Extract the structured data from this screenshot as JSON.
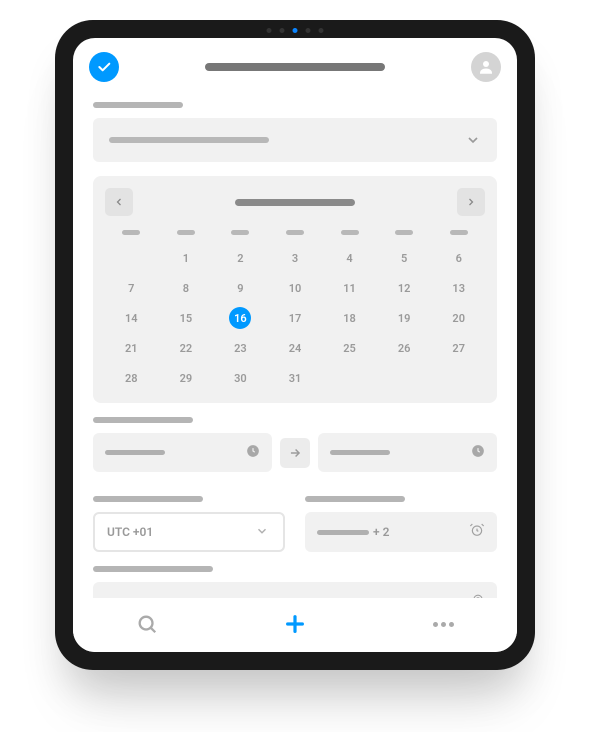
{
  "colors": {
    "accent": "#0099ff",
    "muted": "#b5b5b5"
  },
  "header": {
    "title_placeholder": "",
    "logo": "checkmark-circle",
    "avatar": "user"
  },
  "dropdown": {
    "value_placeholder": ""
  },
  "calendar": {
    "month_placeholder": "",
    "selected": 16,
    "day_headers": [
      "",
      "",
      "",
      "",
      "",
      "",
      ""
    ],
    "weeks": [
      [
        "",
        "1",
        "2",
        "3",
        "4",
        "5",
        "6"
      ],
      [
        "7",
        "8",
        "9",
        "10",
        "11",
        "12",
        "13"
      ],
      [
        "14",
        "15",
        "16",
        "17",
        "18",
        "19",
        "20"
      ],
      [
        "21",
        "22",
        "23",
        "24",
        "25",
        "26",
        "27"
      ],
      [
        "28",
        "29",
        "30",
        "31",
        "",
        "",
        ""
      ]
    ]
  },
  "time": {
    "start_placeholder": "",
    "end_placeholder": ""
  },
  "timezone": {
    "value": "UTC +01"
  },
  "reminder": {
    "prefix_placeholder": "",
    "suffix": "+ 2"
  },
  "location": {
    "placeholder": ""
  },
  "nav": {
    "search": "search",
    "add": "plus",
    "more": "more"
  }
}
